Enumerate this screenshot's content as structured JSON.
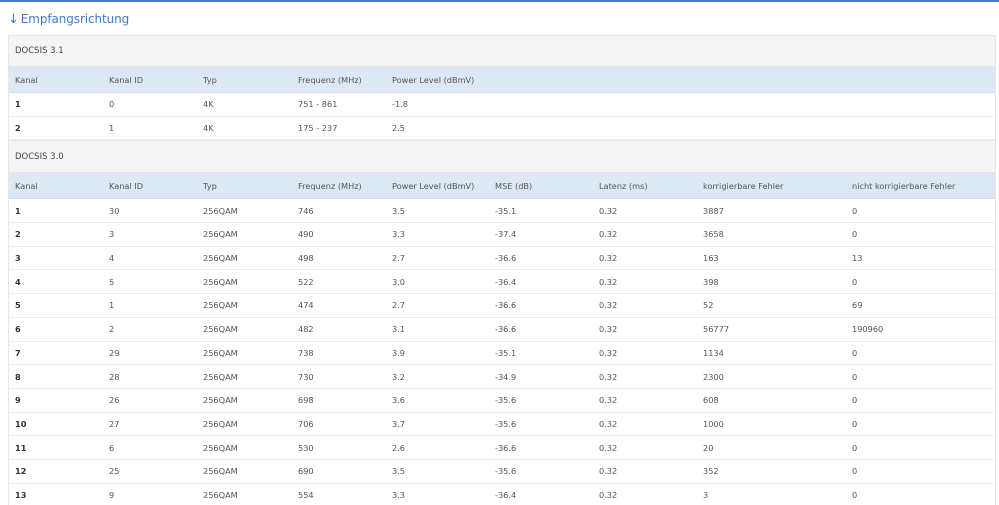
{
  "heading": {
    "arrow": "↓",
    "title": "Empfangsrichtung"
  },
  "docsis31": {
    "title": "DOCSIS 3.1",
    "columns": [
      "Kanal",
      "Kanal ID",
      "Typ",
      "Frequenz (MHz)",
      "Power Level (dBmV)"
    ],
    "rows": [
      [
        "1",
        "0",
        "4K",
        "751 - 861",
        "-1.8"
      ],
      [
        "2",
        "1",
        "4K",
        "175 - 237",
        "2.5"
      ]
    ]
  },
  "docsis30": {
    "title": "DOCSIS 3.0",
    "columns": [
      "Kanal",
      "Kanal ID",
      "Typ",
      "Frequenz (MHz)",
      "Power Level (dBmV)",
      "MSE (dB)",
      "Latenz (ms)",
      "korrigierbare Fehler",
      "nicht korrigierbare Fehler"
    ],
    "rows": [
      [
        "1",
        "30",
        "256QAM",
        "746",
        "3.5",
        "-35.1",
        "0.32",
        "3887",
        "0"
      ],
      [
        "2",
        "3",
        "256QAM",
        "490",
        "3.3",
        "-37.4",
        "0.32",
        "3658",
        "0"
      ],
      [
        "3",
        "4",
        "256QAM",
        "498",
        "2.7",
        "-36.6",
        "0.32",
        "163",
        "13"
      ],
      [
        "4",
        "5",
        "256QAM",
        "522",
        "3.0",
        "-36.4",
        "0.32",
        "398",
        "0"
      ],
      [
        "5",
        "1",
        "256QAM",
        "474",
        "2.7",
        "-36.6",
        "0.32",
        "52",
        "69"
      ],
      [
        "6",
        "2",
        "256QAM",
        "482",
        "3.1",
        "-36.6",
        "0.32",
        "56777",
        "190960"
      ],
      [
        "7",
        "29",
        "256QAM",
        "738",
        "3.9",
        "-35.1",
        "0.32",
        "1134",
        "0"
      ],
      [
        "8",
        "28",
        "256QAM",
        "730",
        "3.2",
        "-34.9",
        "0.32",
        "2300",
        "0"
      ],
      [
        "9",
        "26",
        "256QAM",
        "698",
        "3.6",
        "-35.6",
        "0.32",
        "608",
        "0"
      ],
      [
        "10",
        "27",
        "256QAM",
        "706",
        "3.7",
        "-35.6",
        "0.32",
        "1000",
        "0"
      ],
      [
        "11",
        "6",
        "256QAM",
        "530",
        "2.6",
        "-36.6",
        "0.32",
        "20",
        "0"
      ],
      [
        "12",
        "25",
        "256QAM",
        "690",
        "3.5",
        "-35.6",
        "0.32",
        "352",
        "0"
      ],
      [
        "13",
        "9",
        "256QAM",
        "554",
        "3.3",
        "-36.4",
        "0.32",
        "3",
        "0"
      ]
    ]
  }
}
